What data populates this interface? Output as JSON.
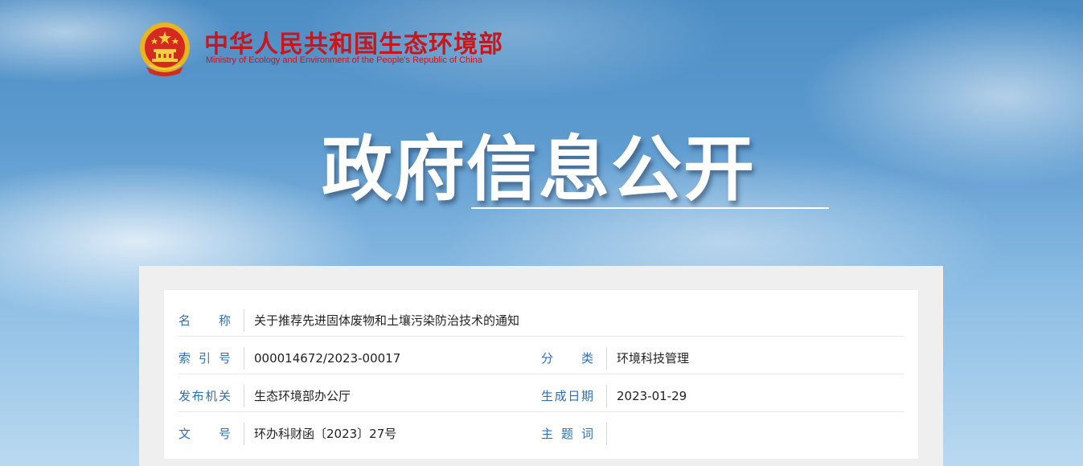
{
  "header": {
    "org_name_cn": "中华人民共和国生态环境部",
    "org_name_en": "Ministry of Ecology and Environment of the People's Republic of China",
    "emblem_icon": "national-emblem-icon"
  },
  "banner": {
    "title": "政府信息公开"
  },
  "info": {
    "name_label": "名称",
    "name_value": "关于推荐先进固体废物和土壤污染防治技术的通知",
    "index_label": "索引号",
    "index_value": "000014672/2023-00017",
    "category_label": "分类",
    "category_value": "环境科技管理",
    "issuer_label": "发布机关",
    "issuer_value": "生态环境部办公厅",
    "date_label": "生成日期",
    "date_value": "2023-01-29",
    "docno_label": "文号",
    "docno_value": "环办科财函〔2023〕27号",
    "subject_label": "主题词",
    "subject_value": ""
  },
  "colors": {
    "brand_red": "#c8161d",
    "label_blue": "#2f6fb5",
    "emblem_gold": "#f0c020"
  }
}
